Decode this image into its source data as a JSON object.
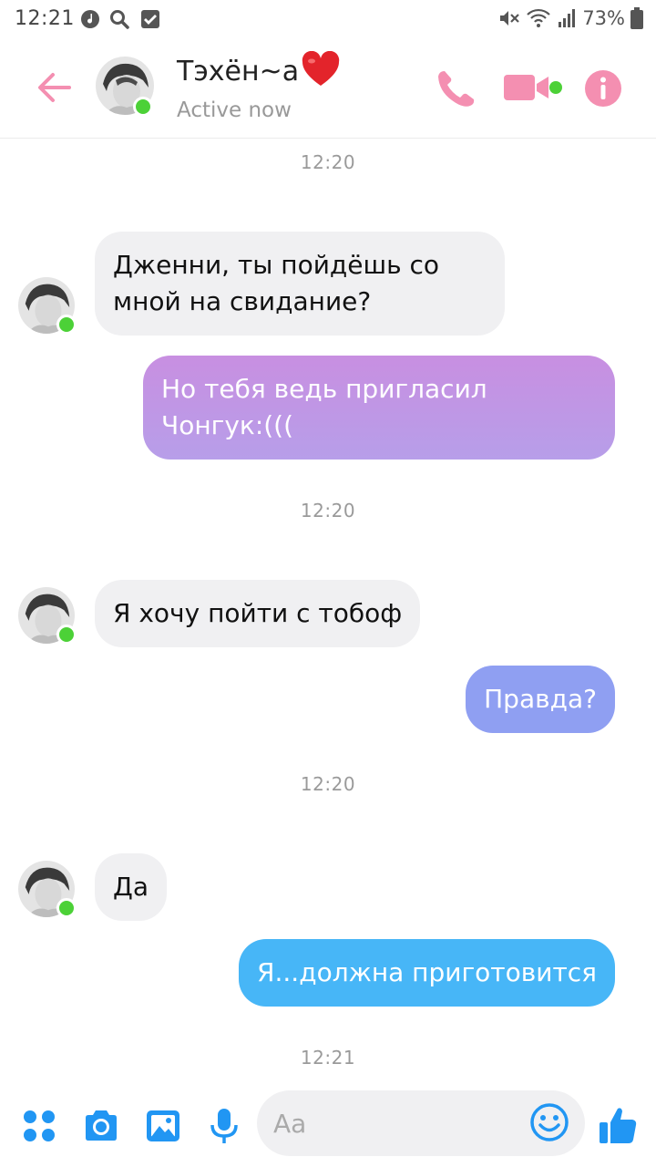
{
  "status_bar": {
    "time": "12:21",
    "battery": "73%"
  },
  "header": {
    "contact_name": "Тэхён~а",
    "contact_status": "Active now"
  },
  "messages": {
    "ts1": "12:20",
    "m1": {
      "line1": "Дженни, ты пойдёшь со",
      "line2": "мной на свидание?"
    },
    "m2": {
      "line1": "Но тебя ведь пригласил",
      "line2": "Чонгук:((("
    },
    "ts2": "12:20",
    "m3": "Я хочу пойти с тобоф",
    "m4": "Правда?",
    "ts3": "12:20",
    "m5": "Да",
    "m6": "Я...должна приготовится",
    "ts4": "12:21"
  },
  "composer": {
    "placeholder": "Aa"
  },
  "colors": {
    "accent_pink": "#f48fb1",
    "bubble_purple_top": "#c78fe0",
    "bubble_purple_bottom": "#b89be8",
    "bubble_periwinkle": "#8f9ff2",
    "bubble_blue": "#47b6f7",
    "composer_blue": "#2196f3"
  },
  "icons": {
    "back": "arrow-left-icon",
    "call": "phone-icon",
    "video": "video-camera-icon",
    "info": "info-icon",
    "apps": "four-dots-icon",
    "camera": "camera-icon",
    "gallery": "image-icon",
    "mic": "microphone-icon",
    "emoji": "smiley-icon",
    "like": "thumbs-up-icon"
  }
}
